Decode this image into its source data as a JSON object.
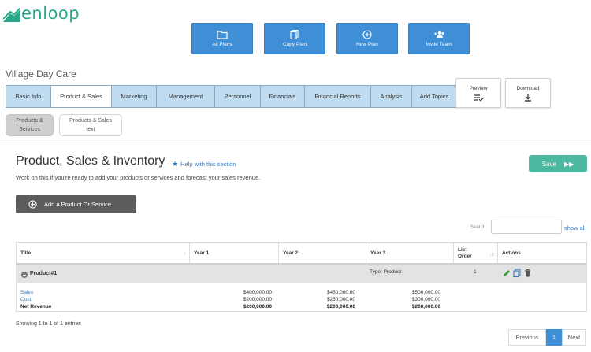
{
  "brand": {
    "name": "enloop",
    "color": "#27a888"
  },
  "top_actions": [
    {
      "label": "All Plans",
      "icon": "folder-icon"
    },
    {
      "label": "Copy Plan",
      "icon": "copy-icon"
    },
    {
      "label": "New Plan",
      "icon": "plus-circle-icon"
    },
    {
      "label": "Invite Team",
      "icon": "team-icon"
    }
  ],
  "plan_title": "Village Day Care",
  "tabs": [
    {
      "label": "Basic Info",
      "active": false
    },
    {
      "label": "Product & Sales",
      "active": true
    },
    {
      "label": "Marketing",
      "active": false
    },
    {
      "label": "Management",
      "active": false
    },
    {
      "label": "Personnel",
      "active": false
    },
    {
      "label": "Financials",
      "active": false
    },
    {
      "label": "Financial Reports",
      "active": false
    },
    {
      "label": "Analysis",
      "active": false
    },
    {
      "label": "Add Topics",
      "active": false
    }
  ],
  "preview": {
    "label": "Preview",
    "icon": "list-check-icon"
  },
  "download": {
    "label": "Download",
    "icon": "download-icon"
  },
  "subtabs": [
    {
      "line1": "Products &",
      "line2": "Services",
      "active": true
    },
    {
      "line1": "Products & Sales",
      "line2": "text",
      "active": false
    }
  ],
  "section": {
    "title": "Product, Sales & Inventory",
    "help": "Help with this section",
    "intro": "Work on this if you're ready to add your products or services and forecast your sales revenue.",
    "save_label": "Save",
    "add_label": "Add A Product Or Service"
  },
  "search": {
    "label": "Search",
    "value": "",
    "show_all": "show all"
  },
  "table": {
    "columns": [
      "Title",
      "Year 1",
      "Year 2",
      "Year 3",
      "List",
      "Order",
      "Actions"
    ],
    "product": {
      "name": "Product#1",
      "type": "Type: Product",
      "order": "1"
    },
    "rows": [
      {
        "label": "Sales",
        "y1": "$400,000.00",
        "y2": "$450,000.00",
        "y3": "$500,000.00"
      },
      {
        "label": "Cost",
        "y1": "$200,000.00",
        "y2": "$250,000.00",
        "y3": "$300,000.00"
      },
      {
        "label": "Net Revenue",
        "y1": "$200,000.00",
        "y2": "$200,000.00",
        "y3": "$200,000.00"
      }
    ]
  },
  "entries_text": "Showing 1 to 1 of 1 entries",
  "pagination": {
    "previous": "Previous",
    "current": "1",
    "next": "Next"
  },
  "colors": {
    "primary": "#3f8fd6",
    "tab_bg": "#bfdcf1",
    "save": "#4cb8a0",
    "dark_button": "#5c5c5c",
    "link": "#3a7bbf"
  }
}
